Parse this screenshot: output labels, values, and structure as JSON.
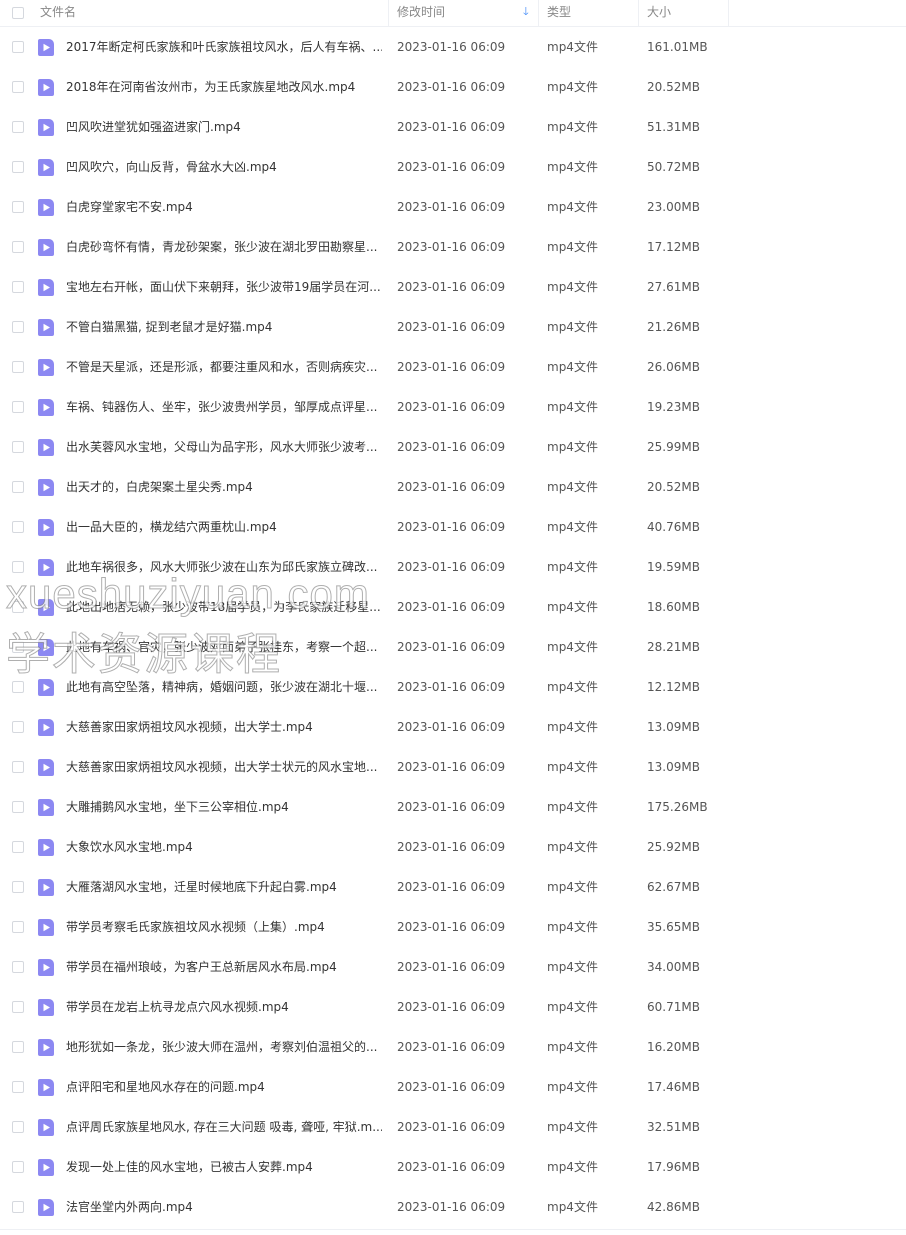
{
  "columns": {
    "name": "文件名",
    "modified": "修改时间",
    "type": "类型",
    "size": "大小"
  },
  "colors": {
    "accent": "#3a86f7",
    "file_icon": "#8c88f2"
  },
  "icons": {
    "file": "video-file-icon",
    "sort": "sort-down-arrow-icon"
  },
  "files": [
    {
      "name": "2017年断定柯氏家族和叶氏家族祖坟风水，后人有车祸、...",
      "modified": "2023-01-16 06:09",
      "type": "mp4文件",
      "size": "161.01MB"
    },
    {
      "name": "2018年在河南省汝州市，为王氏家族星地改风水.mp4",
      "modified": "2023-01-16 06:09",
      "type": "mp4文件",
      "size": "20.52MB"
    },
    {
      "name": "凹风吹进堂犹如强盗进家门.mp4",
      "modified": "2023-01-16 06:09",
      "type": "mp4文件",
      "size": "51.31MB"
    },
    {
      "name": "凹风吹穴，向山反背，骨盆水大凶.mp4",
      "modified": "2023-01-16 06:09",
      "type": "mp4文件",
      "size": "50.72MB"
    },
    {
      "name": "白虎穿堂家宅不安.mp4",
      "modified": "2023-01-16 06:09",
      "type": "mp4文件",
      "size": "23.00MB"
    },
    {
      "name": "白虎砂弯怀有情，青龙砂架案，张少波在湖北罗田勘察星...",
      "modified": "2023-01-16 06:09",
      "type": "mp4文件",
      "size": "17.12MB"
    },
    {
      "name": "宝地左右开帐，面山伏下来朝拜，张少波带19届学员在河...",
      "modified": "2023-01-16 06:09",
      "type": "mp4文件",
      "size": "27.61MB"
    },
    {
      "name": "不管白猫黑猫, 捉到老鼠才是好猫.mp4",
      "modified": "2023-01-16 06:09",
      "type": "mp4文件",
      "size": "21.26MB"
    },
    {
      "name": "不管是天星派，还是形派，都要注重风和水，否则病疾灾...",
      "modified": "2023-01-16 06:09",
      "type": "mp4文件",
      "size": "26.06MB"
    },
    {
      "name": "车祸、钝器伤人、坐牢，张少波贵州学员，邹厚成点评星...",
      "modified": "2023-01-16 06:09",
      "type": "mp4文件",
      "size": "19.23MB"
    },
    {
      "name": "出水芙蓉风水宝地，父母山为品字形，风水大师张少波考...",
      "modified": "2023-01-16 06:09",
      "type": "mp4文件",
      "size": "25.99MB"
    },
    {
      "name": "出天才的，白虎架案土星尖秀.mp4",
      "modified": "2023-01-16 06:09",
      "type": "mp4文件",
      "size": "20.52MB"
    },
    {
      "name": "出一品大臣的，横龙结穴两重枕山.mp4",
      "modified": "2023-01-16 06:09",
      "type": "mp4文件",
      "size": "40.76MB"
    },
    {
      "name": "此地车祸很多，风水大师张少波在山东为邱氏家族立碑改...",
      "modified": "2023-01-16 06:09",
      "type": "mp4文件",
      "size": "19.59MB"
    },
    {
      "name": "此地出地痞无赖，张少波带18届学员，为李氏家族迁移星...",
      "modified": "2023-01-16 06:09",
      "type": "mp4文件",
      "size": "18.60MB"
    },
    {
      "name": "此地有车祸、官灾，张少波对面弟子张桂东，考察一个超...",
      "modified": "2023-01-16 06:09",
      "type": "mp4文件",
      "size": "28.21MB"
    },
    {
      "name": "此地有高空坠落，精神病，婚姻问题，张少波在湖北十堰...",
      "modified": "2023-01-16 06:09",
      "type": "mp4文件",
      "size": "12.12MB"
    },
    {
      "name": "大慈善家田家炳祖坟风水视频，出大学士.mp4",
      "modified": "2023-01-16 06:09",
      "type": "mp4文件",
      "size": "13.09MB"
    },
    {
      "name": "大慈善家田家炳祖坟风水视频，出大学士状元的风水宝地...",
      "modified": "2023-01-16 06:09",
      "type": "mp4文件",
      "size": "13.09MB"
    },
    {
      "name": "大雕捕鹅风水宝地，坐下三公宰相位.mp4",
      "modified": "2023-01-16 06:09",
      "type": "mp4文件",
      "size": "175.26MB"
    },
    {
      "name": "大象饮水风水宝地.mp4",
      "modified": "2023-01-16 06:09",
      "type": "mp4文件",
      "size": "25.92MB"
    },
    {
      "name": "大雁落湖风水宝地，迁星时候地底下升起白雾.mp4",
      "modified": "2023-01-16 06:09",
      "type": "mp4文件",
      "size": "62.67MB"
    },
    {
      "name": "带学员考察毛氏家族祖坟风水视频（上集）.mp4",
      "modified": "2023-01-16 06:09",
      "type": "mp4文件",
      "size": "35.65MB"
    },
    {
      "name": "带学员在福州琅岐，为客户王总新居风水布局.mp4",
      "modified": "2023-01-16 06:09",
      "type": "mp4文件",
      "size": "34.00MB"
    },
    {
      "name": "带学员在龙岩上杭寻龙点穴风水视频.mp4",
      "modified": "2023-01-16 06:09",
      "type": "mp4文件",
      "size": "60.71MB"
    },
    {
      "name": "地形犹如一条龙，张少波大师在温州，考察刘伯温祖父的...",
      "modified": "2023-01-16 06:09",
      "type": "mp4文件",
      "size": "16.20MB"
    },
    {
      "name": "点评阳宅和星地风水存在的问题.mp4",
      "modified": "2023-01-16 06:09",
      "type": "mp4文件",
      "size": "17.46MB"
    },
    {
      "name": "点评周氏家族星地风水, 存在三大问题 吸毒, 聋哑, 牢狱.m...",
      "modified": "2023-01-16 06:09",
      "type": "mp4文件",
      "size": "32.51MB"
    },
    {
      "name": "发现一处上佳的风水宝地，已被古人安葬.mp4",
      "modified": "2023-01-16 06:09",
      "type": "mp4文件",
      "size": "17.96MB"
    },
    {
      "name": "法官坐堂内外两向.mp4",
      "modified": "2023-01-16 06:09",
      "type": "mp4文件",
      "size": "42.86MB"
    }
  ],
  "watermark": {
    "line1": "xueshuziyuan.com",
    "line2": "学术资源课程"
  }
}
